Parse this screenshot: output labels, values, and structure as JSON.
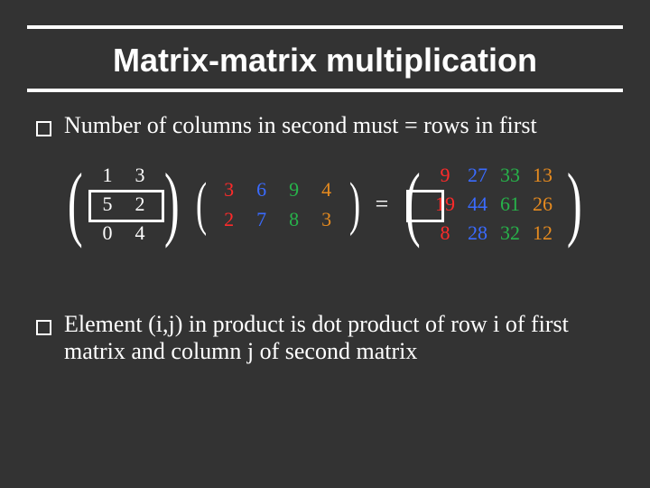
{
  "title": "Matrix-matrix multiplication",
  "bullets": {
    "b1": "Number of columns in second must  = rows in first",
    "b2": "Element (i,j) in product is dot product of row i of first matrix and column j of second matrix"
  },
  "equals": "=",
  "matrixA": {
    "r0c0": "1",
    "r0c1": "3",
    "r1c0": "5",
    "r1c1": "2",
    "r2c0": "0",
    "r2c1": "4"
  },
  "matrixB": {
    "r0c0": "3",
    "r0c1": "6",
    "r0c2": "9",
    "r0c3": "4",
    "r1c0": "2",
    "r1c1": "7",
    "r1c2": "8",
    "r1c3": "3"
  },
  "matrixC": {
    "r0c0": "9",
    "r0c1": "27",
    "r0c2": "33",
    "r0c3": "13",
    "r1c0": "19",
    "r1c1": "44",
    "r1c2": "61",
    "r1c3": "26",
    "r2c0": "8",
    "r2c1": "28",
    "r2c2": "32",
    "r2c3": "12"
  }
}
